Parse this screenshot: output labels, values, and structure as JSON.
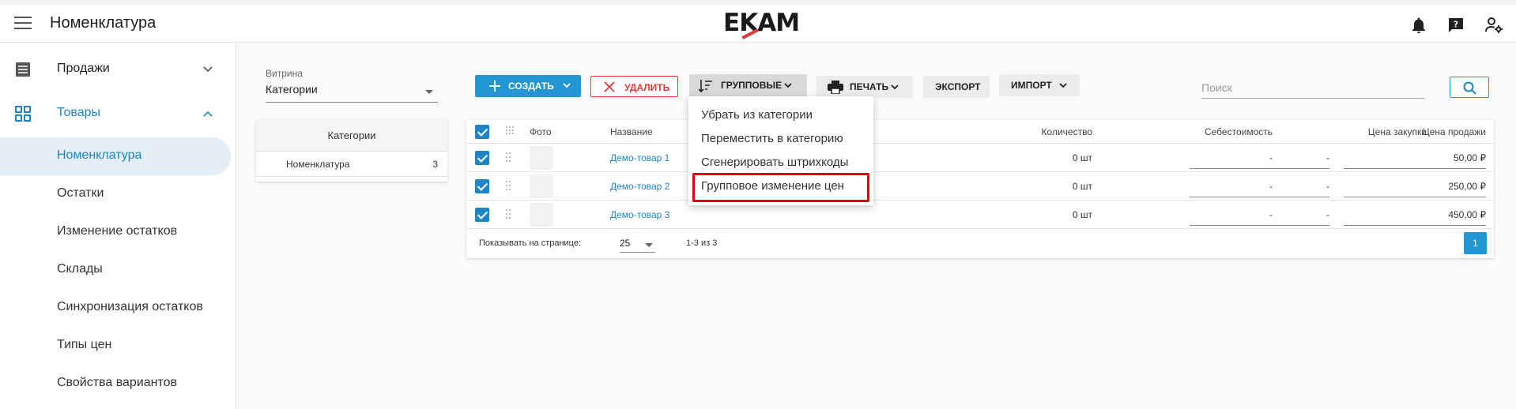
{
  "header": {
    "title": "Номенклатура",
    "logo": "EKAM",
    "icons": [
      "menu-icon",
      "bell-icon",
      "chat-question-icon",
      "user-settings-icon"
    ]
  },
  "sidebar": {
    "groups": [
      {
        "label": "Продажи",
        "icon": "list-icon",
        "expanded": false
      },
      {
        "label": "Товары",
        "icon": "grid-icon",
        "expanded": true
      }
    ],
    "items": [
      {
        "label": "Номенклатура",
        "active": true
      },
      {
        "label": "Остатки"
      },
      {
        "label": "Изменение остатков"
      },
      {
        "label": "Склады"
      },
      {
        "label": "Синхронизация остатков"
      },
      {
        "label": "Типы цен"
      },
      {
        "label": "Свойства вариантов"
      }
    ]
  },
  "vitrina": {
    "label": "Витрина",
    "value": "Категории"
  },
  "categories": {
    "header": "Категории",
    "rows": [
      {
        "name": "Номенклатура",
        "count": "3"
      }
    ]
  },
  "toolbar": {
    "create": "СОЗДАТЬ",
    "delete": "УДАЛИТЬ",
    "group": "ГРУППОВЫЕ",
    "print": "ПЕЧАТЬ",
    "export": "ЭКСПОРТ",
    "import": "ИМПОРТ"
  },
  "search": {
    "placeholder": "Поиск"
  },
  "table": {
    "columns": {
      "photo": "Фото",
      "name": "Название",
      "quantity": "Количество",
      "cost": "Себестоимость",
      "purchase": "Цена закупки",
      "sale": "Цена продажи"
    },
    "rows": [
      {
        "name": "Демо-товар 1",
        "quantity": "0 шт",
        "cost": "-",
        "purchase": "-",
        "sale": "50,00 ₽"
      },
      {
        "name": "Демо-товар 2",
        "quantity": "0 шт",
        "cost": "-",
        "purchase": "-",
        "sale": "250,00 ₽"
      },
      {
        "name": "Демо-товар 3",
        "quantity": "0 шт",
        "cost": "-",
        "purchase": "-",
        "sale": "450,00 ₽"
      }
    ],
    "footer": {
      "per_page_label": "Показывать на странице:",
      "per_page": "25",
      "range": "1-3 из 3",
      "page": "1"
    }
  },
  "group_menu": {
    "items": [
      "Убрать из категории",
      "Переместить в категорию",
      "Сгенерировать штрихкоды",
      "Групповое изменение цен"
    ],
    "highlighted": "Групповое изменение цен",
    "highlight_color": "#e3000f"
  },
  "colors": {
    "accent": "#2196d3",
    "link": "#1c86c8",
    "danger": "#e53935"
  }
}
